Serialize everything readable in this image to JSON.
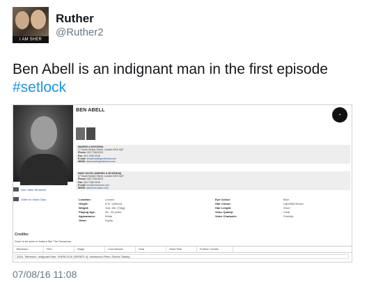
{
  "tweet": {
    "avatar_caption": "I AM SHER LOCKED",
    "display_name": "Ruther",
    "handle": "@Ruther2",
    "text": "Ben Abell is an indignant man in the first episode",
    "hashtag": "#setlock",
    "timestamp": "07/08/16 11:08"
  },
  "profile": {
    "name": "BEN ABELL",
    "photo_credit": "Photo: Pete Bartlett",
    "left_links": [
      "See Video Showreel",
      "Listen to Voice Clips"
    ],
    "agents": [
      {
        "lines": [
          {
            "label": "",
            "value": "MARING & MCKENNA"
          },
          {
            "label": "",
            "value": "17 South Molton Street, London W1K 5QT"
          },
          {
            "label": "Phone:",
            "value": "020 7036 8222"
          },
          {
            "label": "Fax:",
            "value": "020 7036 9108"
          },
          {
            "label": "E-mail:",
            "value": "info@marlingmckenna.com"
          },
          {
            "label": "WWW:",
            "value": "www.marlingmckenna.com"
          }
        ]
      },
      {
        "lines": [
          {
            "label": "",
            "value": "M&M VOICES (MARING & MCKENNA)"
          },
          {
            "label": "",
            "value": "17 South Molton Street, London W1K 5QT"
          },
          {
            "label": "Phone:",
            "value": "020 7036 8222"
          },
          {
            "label": "Fax:",
            "value": "020 7036 9108"
          },
          {
            "label": "E-mail:",
            "value": "info@mmvoices.com"
          },
          {
            "label": "WWW:",
            "value": "www.mmvoices.com"
          }
        ]
      }
    ],
    "attributes_left": [
      {
        "k": "Location:",
        "v": "London"
      },
      {
        "k": "Height:",
        "v": "5'11\" (180cm)"
      },
      {
        "k": "Weight:",
        "v": "11st. 6lb. (76kg)"
      },
      {
        "k": "Playing Age:",
        "v": "35 - 45 years"
      },
      {
        "k": "Appearance:",
        "v": "White"
      },
      {
        "k": "Other:",
        "v": "Equity"
      }
    ],
    "attributes_right": [
      {
        "k": "Eye Colour:",
        "v": "Blue"
      },
      {
        "k": "Hair Colour:",
        "v": "Light/Mid Brown"
      },
      {
        "k": "Hair Length:",
        "v": "Short"
      },
      {
        "k": "Voice Quality:",
        "v": "Clear"
      },
      {
        "k": "Voice Character:",
        "v": "Friendly"
      }
    ],
    "credits_title": "Credits:",
    "credits_note": "Soon to be seen in feature film The Snowman.",
    "credit_tabs": [
      "Television",
      "Film",
      "Stage",
      "Commercial",
      "Viral",
      "Short Film",
      "Further Credits"
    ],
    "credit_row": "2016, Television, Indignant Man, SHERLOCK (SERIES 4), Hartswood Films, Rachel Talalay"
  }
}
